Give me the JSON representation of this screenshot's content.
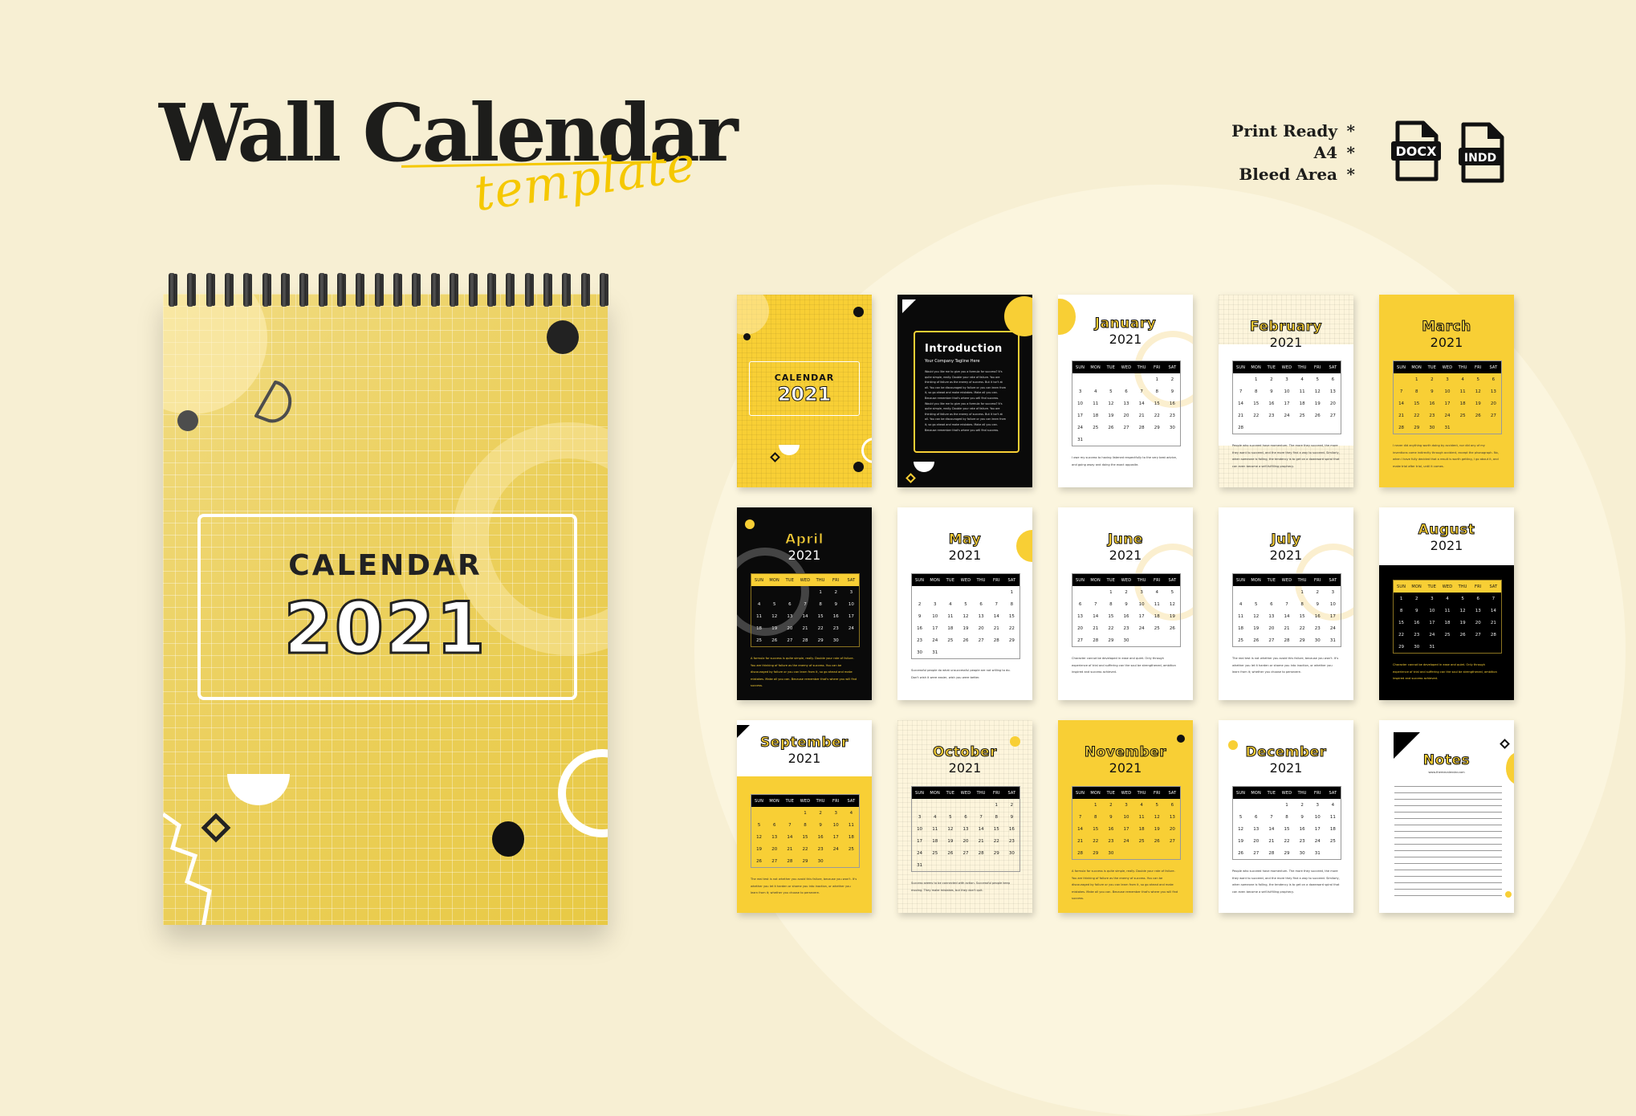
{
  "header": {
    "title": "Wall Calendar",
    "subtitle": "template",
    "features": [
      "Print Ready",
      "A4",
      "Bleed Area"
    ],
    "feature_marker": "*",
    "file_formats": [
      {
        "icon": "docx-file-icon",
        "label": "DOCX"
      },
      {
        "icon": "indd-file-icon",
        "label": "INDD"
      }
    ]
  },
  "colors": {
    "background": "#f7efd3",
    "accent_yellow": "#f8cf35",
    "black": "#0a0a0a",
    "cream": "#fdf5dc"
  },
  "mockup": {
    "cover_label": "CALENDAR",
    "cover_year": "2021"
  },
  "weekdays": [
    "SUN",
    "MON",
    "TUE",
    "WED",
    "THU",
    "FRI",
    "SAT"
  ],
  "pages": [
    {
      "type": "cover",
      "label": "CALENDAR",
      "year": "2021"
    },
    {
      "type": "intro",
      "title": "Introduction",
      "tagline": "Your Company Tagline Here",
      "text": "Would you like me to give you a formula for success? It's quite simple, really. Double your rate of failure. You are thinking of failure as the enemy of success. But it isn't at all. You can be discouraged by failure or you can learn from it, so go ahead and make mistakes. Make all you can. Because remember that's where you will find success. Would you like me to give you a formula for success? It's quite simple, really. Double your rate of failure. You are thinking of failure as the enemy of success. But it isn't at all. You can be discouraged by failure or you can learn from it, so go ahead and make mistakes. Make all you can. Because remember that's where you will find success."
    },
    {
      "type": "month",
      "month": "January",
      "year": "2021",
      "start": 5,
      "days": 31,
      "theme": "white",
      "text": "I owe my success to having listened respectfully to the very best advice, and going away and doing the exact opposite."
    },
    {
      "type": "month",
      "month": "February",
      "year": "2021",
      "start": 1,
      "days": 28,
      "theme": "cream",
      "text": "People who succeed have momentum. The more they succeed, the more they want to succeed, and the more they find a way to succeed. Similarly, when someone is failing, the tendency is to get on a downward spiral that can even become a self-fulfilling prophecy."
    },
    {
      "type": "month",
      "month": "March",
      "year": "2021",
      "start": 1,
      "days": 31,
      "theme": "yellow",
      "text": "I never did anything worth doing by accident, nor did any of my inventions come indirectly through accident, except the phonograph. No, when I have fully decided that a result is worth getting, I go about it, and make trial after trial, until it comes."
    },
    {
      "type": "month",
      "month": "April",
      "year": "2021",
      "start": 4,
      "days": 30,
      "theme": "black",
      "text": "A formula for success is quite simple, really. Double your rate of failure. You are thinking of failure as the enemy of success. You can be discouraged by failure or you can learn from it, so go ahead and make mistakes. Make all you can. Because remember that's where you will find success."
    },
    {
      "type": "month",
      "month": "May",
      "year": "2021",
      "start": 6,
      "days": 31,
      "theme": "white",
      "text": "Successful people do what unsuccessful people are not willing to do. Don't wish it were easier, wish you were better."
    },
    {
      "type": "month",
      "month": "June",
      "year": "2021",
      "start": 2,
      "days": 30,
      "theme": "white",
      "text": "Character cannot be developed in ease and quiet. Only through experience of trial and suffering can the soul be strengthened, ambition inspired and success achieved."
    },
    {
      "type": "month",
      "month": "July",
      "year": "2021",
      "start": 4,
      "days": 31,
      "theme": "white",
      "text": "The real test is not whether you avoid this failure, because you won't. It's whether you let it harden or shame you into inaction, or whether you learn from it; whether you choose to persevere."
    },
    {
      "type": "month",
      "month": "August",
      "year": "2021",
      "start": 0,
      "days": 31,
      "theme": "black-bottom",
      "text": "Character cannot be developed in ease and quiet. Only through experience of trial and suffering can the soul be strengthened, ambition inspired and success achieved."
    },
    {
      "type": "month",
      "month": "September",
      "year": "2021",
      "start": 3,
      "days": 30,
      "theme": "yellow-bottom",
      "text": "The real test is not whether you avoid this failure, because you won't. It's whether you let it harden or shame you into inaction, or whether you learn from it; whether you choose to persevere."
    },
    {
      "type": "month",
      "month": "October",
      "year": "2021",
      "start": 5,
      "days": 31,
      "theme": "cream",
      "text": "Success seems to be connected with action. Successful people keep moving. They make mistakes, but they don't quit."
    },
    {
      "type": "month",
      "month": "November",
      "year": "2021",
      "start": 1,
      "days": 30,
      "theme": "yellow",
      "text": "A formula for success is quite simple, really. Double your rate of failure. You are thinking of failure as the enemy of success. You can be discouraged by failure or you can learn from it, so go ahead and make mistakes. Make all you can. Because remember that's where you will find success."
    },
    {
      "type": "month",
      "month": "December",
      "year": "2021",
      "start": 3,
      "days": 31,
      "theme": "white",
      "text": "People who succeed have momentum. The more they succeed, the more they want to succeed, and the more they find a way to succeed. Similarly, when someone is failing, the tendency is to get on a downward spiral that can even become a self-fulfilling prophecy."
    },
    {
      "type": "notes",
      "title": "Notes",
      "url": "www.themecalendar.com"
    }
  ]
}
